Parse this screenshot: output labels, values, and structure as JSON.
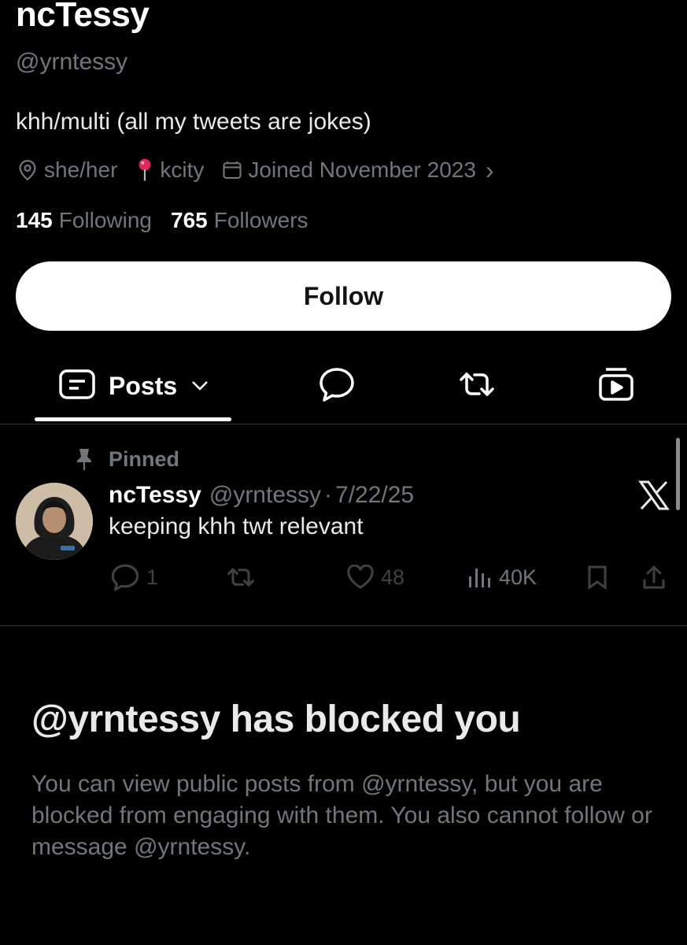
{
  "profile": {
    "display_name": "ncTessy",
    "handle": "@yrntessy",
    "bio": "khh/multi (all my tweets are jokes)",
    "pronouns": "she/her",
    "location": "kcity",
    "joined": "Joined November 2023",
    "joined_chevron": "›",
    "following_count": "145",
    "following_label": "Following",
    "followers_count": "765",
    "followers_label": "Followers",
    "follow_button": "Follow"
  },
  "tabs": {
    "posts_label": "Posts",
    "icons": [
      "posts-icon",
      "replies-icon",
      "reposts-icon",
      "media-icon"
    ]
  },
  "pinned_tweet": {
    "pinned_label": "Pinned",
    "author_name": "ncTessy",
    "author_handle": "@yrntessy",
    "separator": "·",
    "date": "7/22/25",
    "text": "keeping khh twt relevant",
    "reply_count": "1",
    "like_count": "48",
    "view_count": "40K"
  },
  "blocked_notice": {
    "title": "@yrntessy has blocked you",
    "description": "You can view public posts from @yrntessy, but you are blocked from engaging with them. You also cannot follow or message @yrntessy."
  },
  "colors": {
    "background": "#000000",
    "primary_text": "#e7e9ea",
    "secondary_text": "#71767b",
    "disabled_icon": "#3e4144",
    "divider": "#2f3336",
    "follow_button_bg": "#ffffff",
    "pin_location": "#e0245e"
  }
}
